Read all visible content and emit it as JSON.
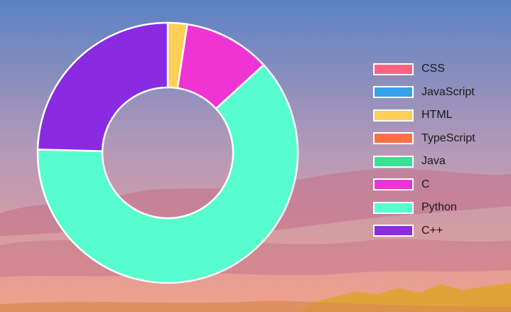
{
  "chart_data": {
    "type": "pie",
    "variant": "doughnut",
    "categories": [
      "CSS",
      "JavaScript",
      "HTML",
      "TypeScript",
      "Java",
      "C",
      "Python",
      "C++"
    ],
    "values": [
      0,
      0,
      2.4,
      0,
      0,
      10.8,
      62.2,
      24.6
    ],
    "value_unit": "percent",
    "colors": [
      "#ff6384",
      "#36a2eb",
      "#ffce56",
      "#ff6f43",
      "#39e191",
      "#ee35d4",
      "#57fdce",
      "#8a2be2"
    ],
    "legend_position": "right",
    "title": ""
  },
  "background": {
    "sky_top": "#5b82c4",
    "sky_mid": "#b89ab8",
    "sky_bottom": "#f2a08a",
    "cloud": "#c26d8a",
    "hill": "#e0a33a"
  }
}
